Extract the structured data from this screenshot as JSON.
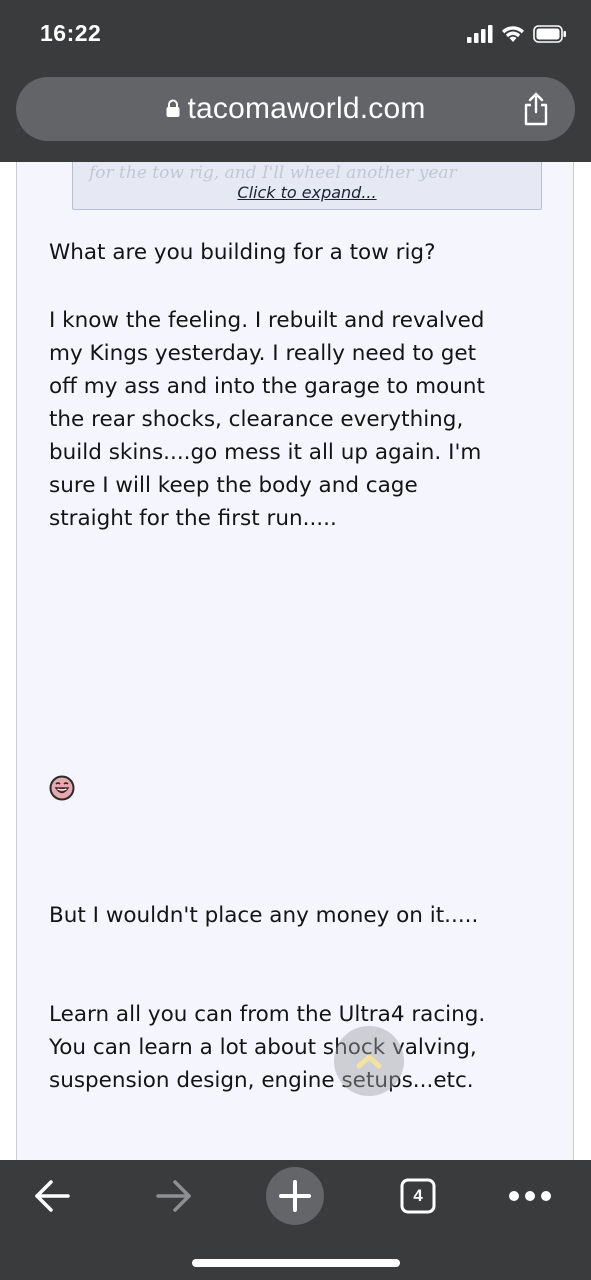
{
  "status_bar": {
    "time": "16:22"
  },
  "browser": {
    "url": "tacomaworld.com",
    "icons": [
      "lock-icon",
      "share-icon"
    ]
  },
  "post": {
    "quote_faded_text": "for the tow rig, and I'll wheel another year",
    "click_to_expand": "Click to expand...",
    "paragraph_1": "What are you building for a tow rig?",
    "paragraph_2": "I know the feeling. I rebuilt and revalved\nmy Kings yesterday. I really need to get\noff my ass and into the garage to mount\nthe rear shocks, clearance everything,\nbuild skins....go mess it all up again. I'm\nsure I will keep the body and cage\nstraight for the first run.....",
    "paragraph_3": "But I wouldn't place any money on it.....",
    "paragraph_4": "Learn all you can from the Ultra4 racing.\nYou can learn a lot about shock valving,\nsuspension design, engine setups...etc.",
    "smiley": "laughing-smiley-icon"
  },
  "toolbar": {
    "tab_count": "4",
    "icons": [
      "back-arrow-icon",
      "forward-arrow-icon",
      "new-tab-plus-icon",
      "tabs-icon",
      "more-dots-icon"
    ]
  },
  "colors": {
    "chrome_bg": "#3a3b3d",
    "url_pill": "#636468",
    "post_bg": "#f4f5fd",
    "quote_bg": "#e6e9f4"
  }
}
